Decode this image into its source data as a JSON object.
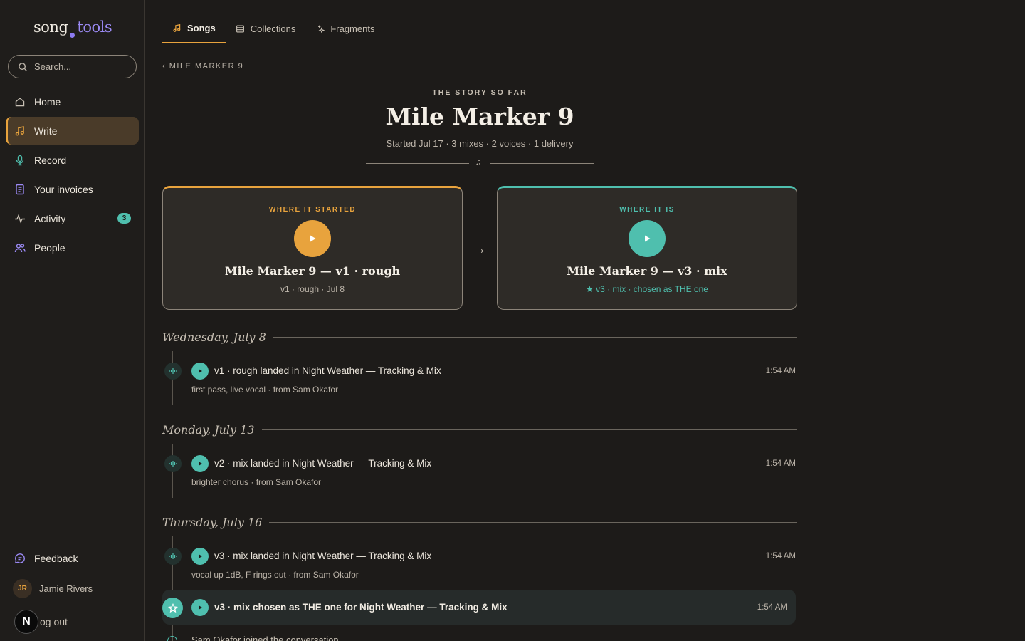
{
  "app": {
    "logo_part1": "song",
    "logo_part2": "tools"
  },
  "search": {
    "placeholder": "Search..."
  },
  "sidebar": {
    "items": [
      {
        "label": "Home",
        "icon": "home-icon"
      },
      {
        "label": "Write",
        "icon": "music-note-icon",
        "active": true
      },
      {
        "label": "Record",
        "icon": "microphone-icon"
      },
      {
        "label": "Your invoices",
        "icon": "invoice-icon"
      },
      {
        "label": "Activity",
        "icon": "activity-icon",
        "badge": "3"
      },
      {
        "label": "People",
        "icon": "people-icon"
      }
    ],
    "feedback_label": "Feedback",
    "user": {
      "initials": "JR",
      "name": "Jamie Rivers"
    },
    "logout_label": "og out",
    "logout_badge": "N"
  },
  "tabs": [
    {
      "label": "Songs",
      "icon": "music-note-icon",
      "active": true
    },
    {
      "label": "Collections",
      "icon": "collection-icon"
    },
    {
      "label": "Fragments",
      "icon": "sparkle-icon"
    }
  ],
  "breadcrumb": "‹ MILE MARKER 9",
  "header": {
    "kicker": "THE STORY SO FAR",
    "title": "Mile Marker 9",
    "meta": "Started Jul 17 · 3 mixes · 2 voices · 1 delivery",
    "ornament": "♫"
  },
  "cards": {
    "start": {
      "label": "WHERE IT STARTED",
      "name": "Mile Marker 9 — v1 · rough",
      "sub": "v1 · rough · Jul 8"
    },
    "arrow": "→",
    "now": {
      "label": "WHERE IT IS",
      "name": "Mile Marker 9 — v3 · mix",
      "sub": "★ v3 · mix · chosen as THE one"
    }
  },
  "timeline": {
    "days": [
      {
        "label": "Wednesday, July 8",
        "events": [
          {
            "text": "v1 · rough landed in Night Weather — Tracking & Mix",
            "note": "first pass, live vocal · from Sam Okafor",
            "time": "1:54 AM"
          }
        ]
      },
      {
        "label": "Monday, July 13",
        "events": [
          {
            "text": "v2 · mix landed in Night Weather — Tracking & Mix",
            "note": "brighter chorus · from Sam Okafor",
            "time": "1:54 AM"
          }
        ]
      },
      {
        "label": "Thursday, July 16",
        "events": [
          {
            "text": "v3 · mix landed in Night Weather — Tracking & Mix",
            "note": "vocal up 1dB, F rings out · from Sam Okafor",
            "time": "1:54 AM"
          }
        ],
        "highlight": {
          "text": "v3 · mix chosen as THE one for Night Weather — Tracking & Mix",
          "time": "1:54 AM"
        },
        "partial": "Sam Okafor joined the conversation"
      }
    ]
  },
  "colors": {
    "accent_orange": "#e8a33d",
    "accent_teal": "#4fbfae",
    "logo_purple": "#9b8af5",
    "background": "#1d1b19"
  }
}
